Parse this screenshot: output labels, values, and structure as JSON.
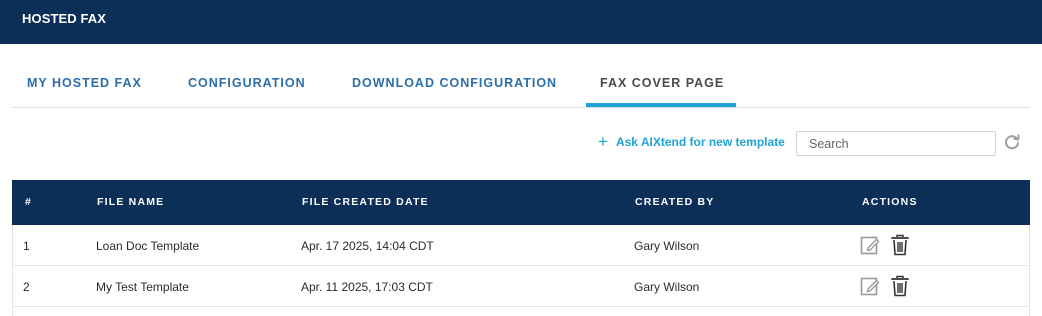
{
  "header": {
    "title": "HOSTED FAX"
  },
  "tabs": [
    {
      "label": "MY HOSTED FAX",
      "active": false
    },
    {
      "label": "CONFIGURATION",
      "active": false
    },
    {
      "label": "DOWNLOAD CONFIGURATION",
      "active": false
    },
    {
      "label": "FAX COVER PAGE",
      "active": true
    }
  ],
  "toolbar": {
    "ai_link_label": "Ask AIXtend for new template",
    "search_placeholder": "Search",
    "search_value": ""
  },
  "table": {
    "columns": [
      "#",
      "FILE NAME",
      "FILE CREATED DATE",
      "CREATED BY",
      "ACTIONS"
    ],
    "rows": [
      {
        "index": "1",
        "file_name": "Loan Doc Template",
        "created_date": "Apr. 17 2025, 14:04 CDT",
        "created_by": "Gary Wilson"
      },
      {
        "index": "2",
        "file_name": "My Test Template",
        "created_date": "Apr. 11 2025, 17:03 CDT",
        "created_by": "Gary Wilson"
      }
    ]
  },
  "colors": {
    "header_bg": "#0b2f57",
    "tab_text": "#2c6ea8",
    "active_tab_underline": "#1fa3d6",
    "link_accent": "#1fa3d6"
  },
  "icons": {
    "refresh": "refresh-icon",
    "edit": "edit-icon",
    "delete": "trash-icon",
    "add": "plus-icon"
  }
}
